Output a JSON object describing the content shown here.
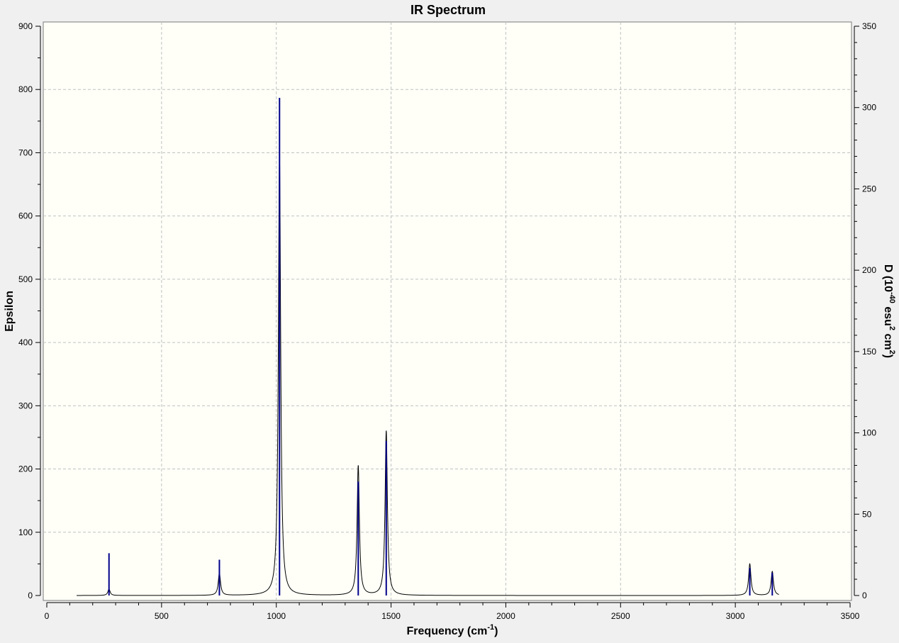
{
  "chart_data": {
    "type": "line",
    "title": "IR Spectrum",
    "xlabel": "Frequency (cm",
    "xlabel_sup": "-1",
    "xlabel_tail": ")",
    "ylabel_left": "Epsilon",
    "ylabel_right": "D (10",
    "ylabel_right_sup1": "-40",
    "ylabel_right_mid": " esu",
    "ylabel_right_sup2": "2",
    "ylabel_right_mid2": " cm",
    "ylabel_right_sup3": "2",
    "ylabel_right_tail": ")",
    "xlim": [
      0,
      3500
    ],
    "ylim_left": [
      0,
      900
    ],
    "ylim_right": [
      0,
      350
    ],
    "x_ticks": [
      "0",
      "500",
      "1000",
      "1500",
      "2000",
      "2500",
      "3000",
      "3500"
    ],
    "y_left_ticks": [
      "0",
      "100",
      "200",
      "300",
      "400",
      "500",
      "600",
      "700",
      "800",
      "900"
    ],
    "y_right_ticks": [
      "0",
      "50",
      "100",
      "150",
      "200",
      "250",
      "300",
      "350"
    ],
    "grid": true,
    "x_range": [
      130,
      3190
    ],
    "peaks": [
      {
        "freq": 271,
        "epsilon": 10,
        "D": 26
      },
      {
        "freq": 752,
        "epsilon": 35,
        "D": 22
      },
      {
        "freq": 1014,
        "epsilon": 695,
        "D": 306
      },
      {
        "freq": 1357,
        "epsilon": 205,
        "D": 70
      },
      {
        "freq": 1479,
        "epsilon": 260,
        "D": 95
      },
      {
        "freq": 3063,
        "epsilon": 50,
        "D": 17
      },
      {
        "freq": 3161,
        "epsilon": 38,
        "D": 14
      }
    ],
    "colors": {
      "background": "#f0f0f0",
      "plot_area": "#fffff8",
      "grid": "#c0c0c0",
      "spectrum": "#000000",
      "sticks": "#00008b"
    }
  }
}
